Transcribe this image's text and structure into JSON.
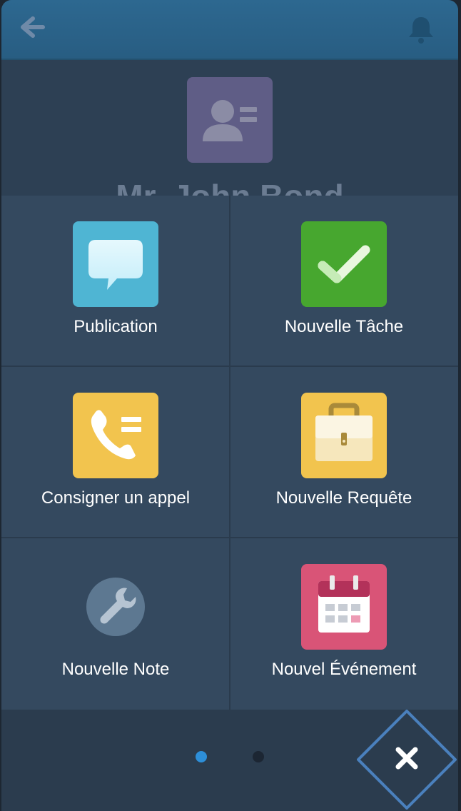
{
  "header": {
    "back_icon": "back-arrow-icon",
    "notification_icon": "bell-icon"
  },
  "contact": {
    "name": "Mr. John Bond",
    "avatar_icon": "contact-card-icon"
  },
  "actions": [
    {
      "label": "Publication",
      "icon": "speech-bubble-icon",
      "color": "#4fb5d3"
    },
    {
      "label": "Nouvelle Tâche",
      "icon": "checkmark-icon",
      "color": "#47a72f"
    },
    {
      "label": "Consigner un appel",
      "icon": "phone-icon",
      "color": "#f2c44e"
    },
    {
      "label": "Nouvelle Requête",
      "icon": "briefcase-icon",
      "color": "#f2c44e"
    },
    {
      "label": "Nouvelle Note",
      "icon": "wrench-icon",
      "color": "#5d7891"
    },
    {
      "label": "Nouvel Événement",
      "icon": "calendar-icon",
      "color": "#d95477"
    }
  ],
  "footer": {
    "page_count": 2,
    "active_page": 1,
    "close_icon": "close-icon"
  },
  "colors": {
    "header": "#2d6890",
    "background": "#34495f",
    "active_dot": "#2d8fd9",
    "inactive_dot": "#1c2633",
    "close_outline": "#4a80bd"
  }
}
